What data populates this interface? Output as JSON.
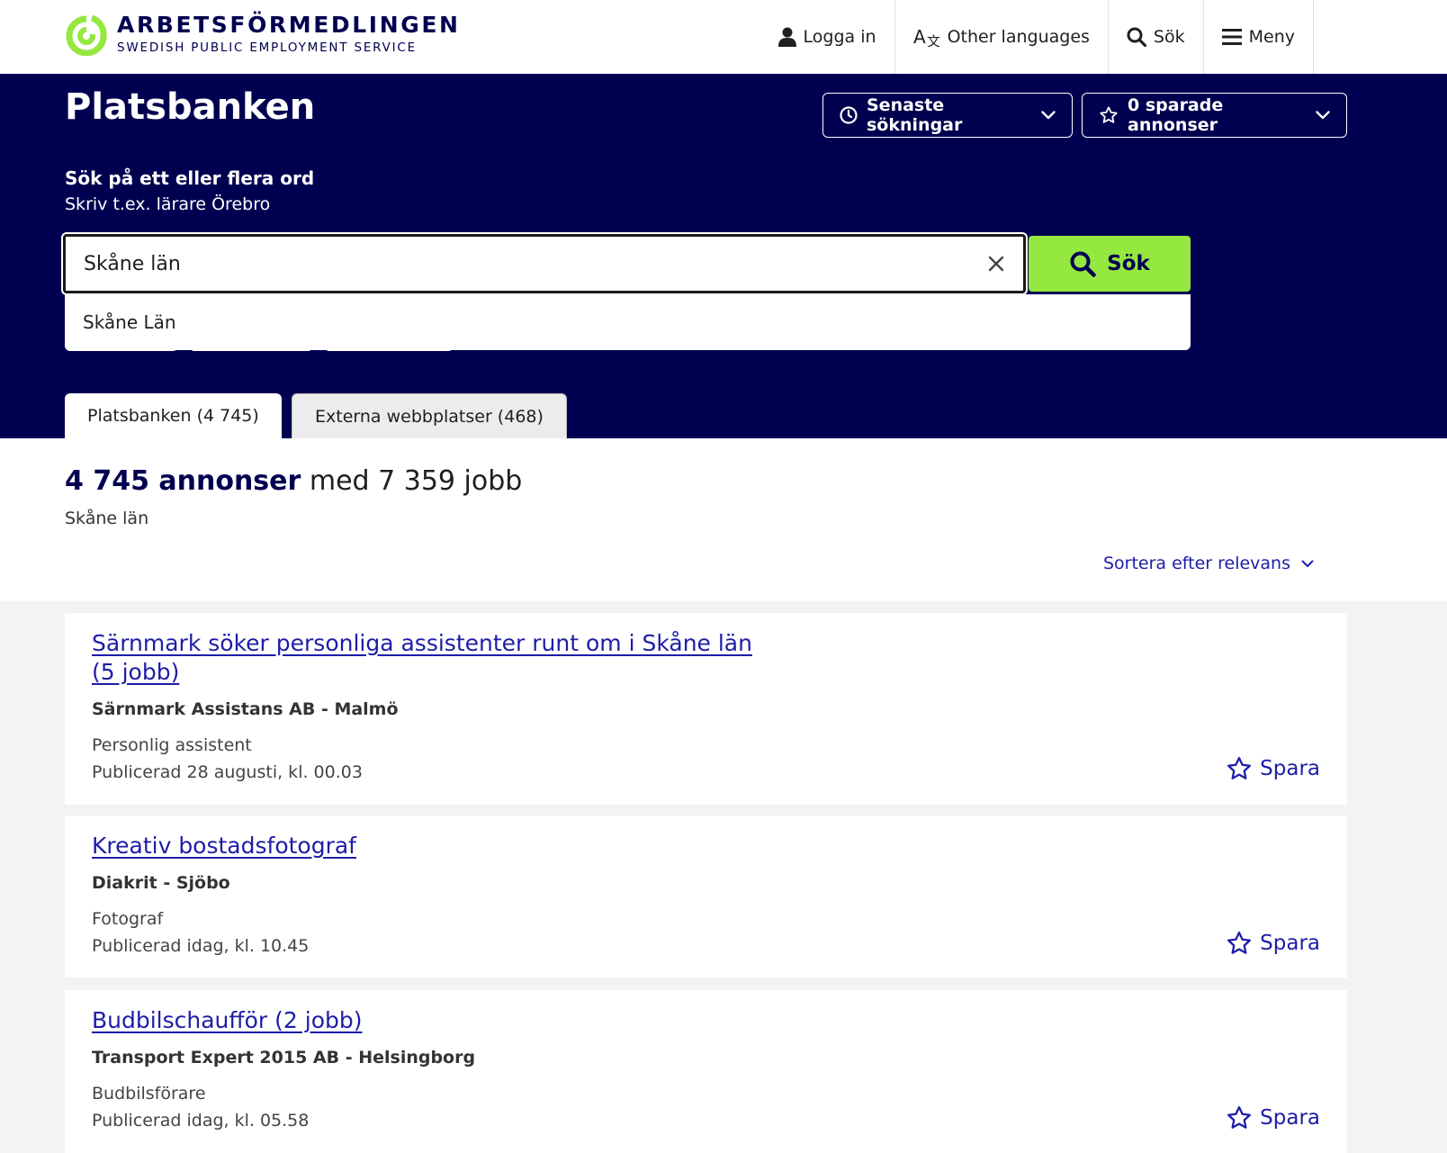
{
  "brand": {
    "name": "ARBETSFÖRMEDLINGEN",
    "tagline": "SWEDISH PUBLIC EMPLOYMENT SERVICE",
    "color_green": "#95e83f",
    "color_navy": "#000050"
  },
  "nav": {
    "login": "Logga in",
    "languages": "Other languages",
    "search": "Sök",
    "menu": "Meny"
  },
  "hero": {
    "title": "Platsbanken",
    "recent_searches": "Senaste sökningar",
    "saved_ads": "0 sparade annonser",
    "search_label": "Sök på ett eller flera ord",
    "search_hint": "Skriv t.ex. lärare Örebro",
    "search_value": "Skåne län",
    "search_button": "Sök",
    "suggestion": "Skåne Län"
  },
  "tabs": [
    {
      "label": "Platsbanken (4 745)",
      "active": true
    },
    {
      "label": "Externa webbplatser (468)",
      "active": false
    }
  ],
  "results": {
    "count_bold": "4 745 annonser",
    "count_rest": " med 7 359 jobb",
    "filter": "Skåne län",
    "sort": "Sortera efter relevans"
  },
  "cards": [
    {
      "title": "Särnmark söker personliga assistenter runt om i Skåne län (5 jobb)",
      "employer": "Särnmark Assistans AB - Malmö",
      "occupation": "Personlig assistent",
      "published": "Publicerad 28 augusti, kl. 00.03",
      "save": "Spara"
    },
    {
      "title": "Kreativ bostadsfotograf",
      "employer": "Diakrit - Sjöbo",
      "occupation": "Fotograf",
      "published": "Publicerad idag, kl. 10.45",
      "save": "Spara"
    },
    {
      "title": "Budbilschaufför (2 jobb)",
      "employer": "Transport Expert 2015 AB - Helsingborg",
      "occupation": "Budbilsförare",
      "published": "Publicerad idag, kl. 05.58",
      "save": "Spara"
    }
  ]
}
